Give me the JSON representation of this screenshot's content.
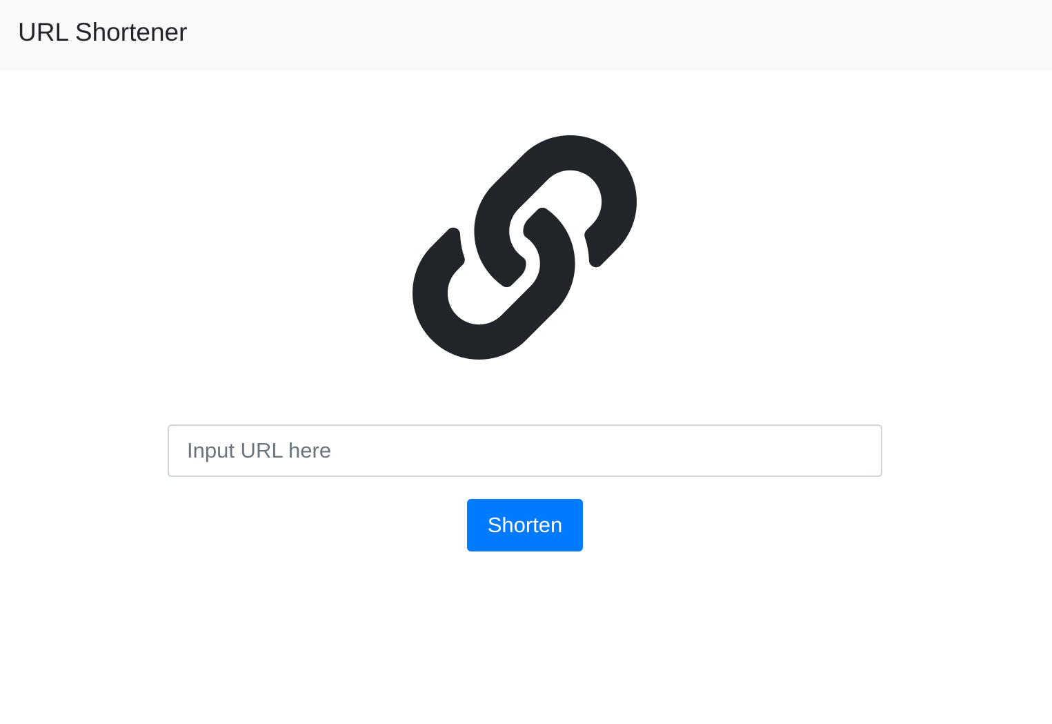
{
  "navbar": {
    "brand": "URL Shortener",
    "background_color": "#f8f9fa"
  },
  "logo": {
    "icon": "link-icon",
    "color": "#212529"
  },
  "form": {
    "url_input": {
      "value": "",
      "placeholder": "Input URL here"
    },
    "shorten_button_label": "Shorten",
    "button_color": "#007bff"
  }
}
